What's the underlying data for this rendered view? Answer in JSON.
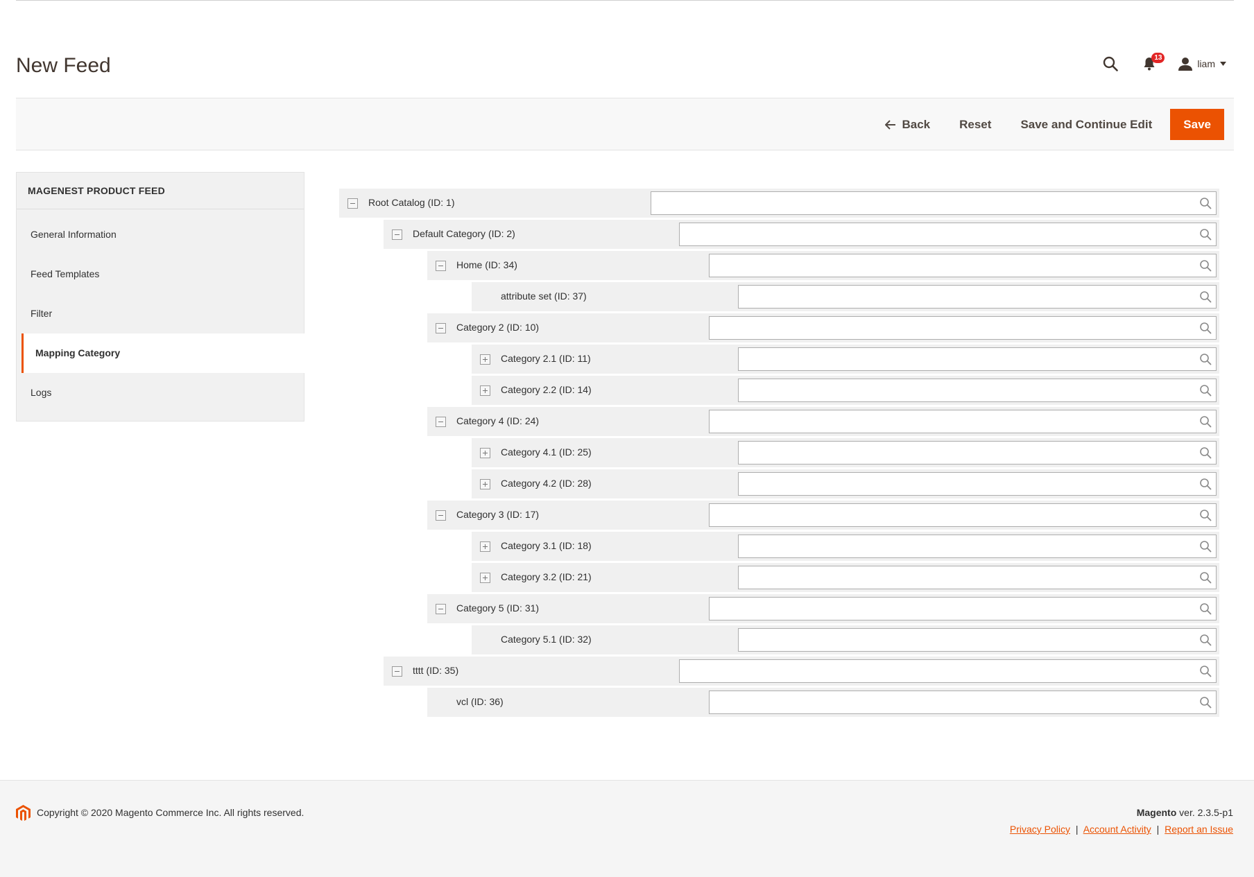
{
  "header": {
    "title": "New Feed",
    "notifications_count": "13",
    "user_name": "liam"
  },
  "toolbar": {
    "back_label": "Back",
    "reset_label": "Reset",
    "save_continue_label": "Save and Continue Edit",
    "save_label": "Save"
  },
  "sidebar": {
    "title": "MAGENEST PRODUCT FEED",
    "items": [
      {
        "label": "General Information"
      },
      {
        "label": "Feed Templates"
      },
      {
        "label": "Filter"
      },
      {
        "label": "Mapping Category"
      },
      {
        "label": "Logs"
      }
    ]
  },
  "tree": {
    "rows": [
      {
        "label": "Root Catalog (ID: 1)",
        "toggle": "minus",
        "value": ""
      },
      {
        "label": "Default Category (ID: 2)",
        "toggle": "minus",
        "value": ""
      },
      {
        "label": "Home (ID: 34)",
        "toggle": "minus",
        "value": ""
      },
      {
        "label": "attribute set (ID: 37)",
        "toggle": "none",
        "value": ""
      },
      {
        "label": "Category 2 (ID: 10)",
        "toggle": "minus",
        "value": ""
      },
      {
        "label": "Category 2.1 (ID: 11)",
        "toggle": "plus",
        "value": ""
      },
      {
        "label": "Category 2.2 (ID: 14)",
        "toggle": "plus",
        "value": ""
      },
      {
        "label": "Category 4 (ID: 24)",
        "toggle": "minus",
        "value": ""
      },
      {
        "label": "Category 4.1 (ID: 25)",
        "toggle": "plus",
        "value": ""
      },
      {
        "label": "Category 4.2 (ID: 28)",
        "toggle": "plus",
        "value": ""
      },
      {
        "label": "Category 3 (ID: 17)",
        "toggle": "minus",
        "value": ""
      },
      {
        "label": "Category 3.1 (ID: 18)",
        "toggle": "plus",
        "value": ""
      },
      {
        "label": "Category 3.2 (ID: 21)",
        "toggle": "plus",
        "value": ""
      },
      {
        "label": "Category 5 (ID: 31)",
        "toggle": "minus",
        "value": ""
      },
      {
        "label": "Category 5.1 (ID: 32)",
        "toggle": "none",
        "value": ""
      },
      {
        "label": "tttt (ID: 35)",
        "toggle": "minus",
        "value": ""
      },
      {
        "label": "vcl (ID: 36)",
        "toggle": "none",
        "value": ""
      }
    ]
  },
  "footer": {
    "copyright": "Copyright © 2020 Magento Commerce Inc. All rights reserved.",
    "brand": "Magento",
    "version": " ver. 2.3.5-p1",
    "links": {
      "privacy": "Privacy Policy",
      "account_activity": "Account Activity",
      "report_issue": "Report an Issue"
    },
    "separator": "|"
  },
  "colors": {
    "accent": "#eb5202",
    "badge": "#e22626",
    "row_background": "#f0f0f0"
  },
  "icons": [
    "search-icon",
    "bell-icon",
    "user-icon",
    "caret-down-icon",
    "arrow-left-icon",
    "magento-logo-icon"
  ]
}
